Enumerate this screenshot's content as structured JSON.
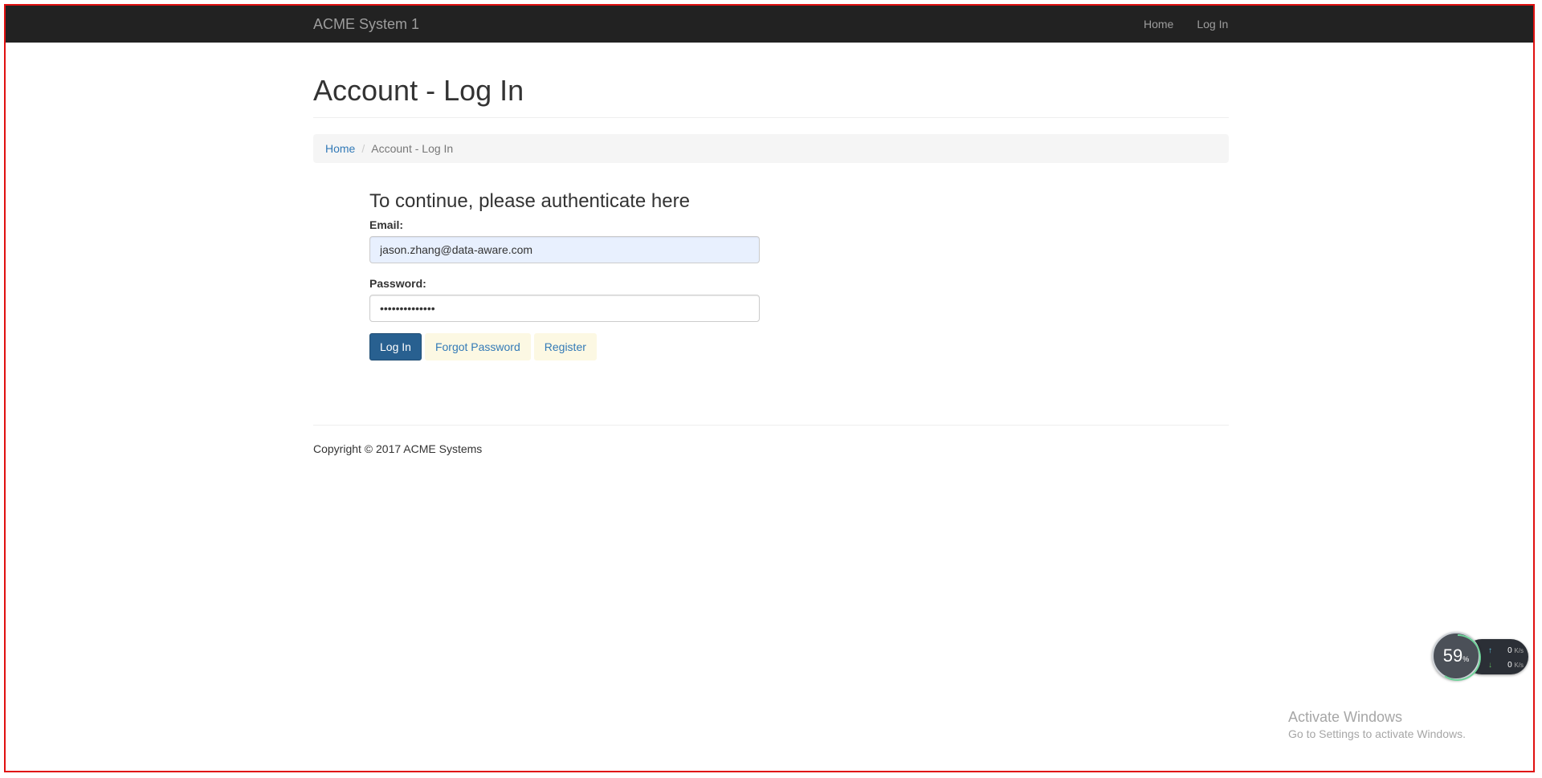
{
  "navbar": {
    "brand": "ACME System 1",
    "links": [
      "Home",
      "Log In"
    ]
  },
  "page": {
    "title": "Account - Log In",
    "breadcrumb": {
      "home": "Home",
      "separator": "/",
      "current": "Account - Log In"
    }
  },
  "login": {
    "heading": "To continue, please authenticate here",
    "email_label": "Email:",
    "email_value": "jason.zhang@data-aware.com",
    "password_label": "Password:",
    "password_value": "••••••••••••••",
    "login_button": "Log In",
    "forgot_button": "Forgot Password",
    "register_button": "Register"
  },
  "footer": {
    "copyright": "Copyright © 2017 ACME Systems"
  },
  "widget": {
    "percent": "59",
    "percent_sign": "%",
    "up_value": "0",
    "down_value": "0",
    "unit": "K/s",
    "up_arrow": "↑",
    "down_arrow": "↓"
  },
  "watermark": {
    "title": "Activate Windows",
    "subtitle": "Go to Settings to activate Windows."
  },
  "colors": {
    "navbar_bg": "#222222",
    "link": "#337ab7",
    "primary_button": "#286090",
    "soft_button_bg": "#fcf8e3",
    "autofill_bg": "#e8f0fe",
    "frame_border": "#e01010"
  }
}
